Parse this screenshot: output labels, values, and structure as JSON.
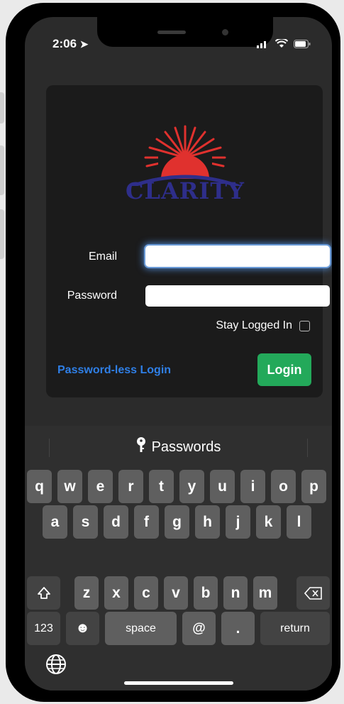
{
  "status": {
    "time": "2:06"
  },
  "logo": {
    "text": "CLARITY",
    "sun_color": "#e0312e",
    "arc_color": "#2e2e8a"
  },
  "form": {
    "email_label": "Email",
    "email_value": "",
    "password_label": "Password",
    "password_value": "",
    "stay_logged_in_label": "Stay Logged In",
    "stay_logged_in_checked": false,
    "passwordless_link": "Password-less Login",
    "login_button": "Login",
    "accent_blue": "#2f7fe6",
    "login_green": "#23a95a"
  },
  "keyboard": {
    "suggestion": "Passwords",
    "row1": [
      "q",
      "w",
      "e",
      "r",
      "t",
      "y",
      "u",
      "i",
      "o",
      "p"
    ],
    "row2": [
      "a",
      "s",
      "d",
      "f",
      "g",
      "h",
      "j",
      "k",
      "l"
    ],
    "row3": [
      "z",
      "x",
      "c",
      "v",
      "b",
      "n",
      "m"
    ],
    "numbers_key": "123",
    "space_key": "space",
    "at_key": "@",
    "dot_key": ".",
    "return_key": "return"
  }
}
